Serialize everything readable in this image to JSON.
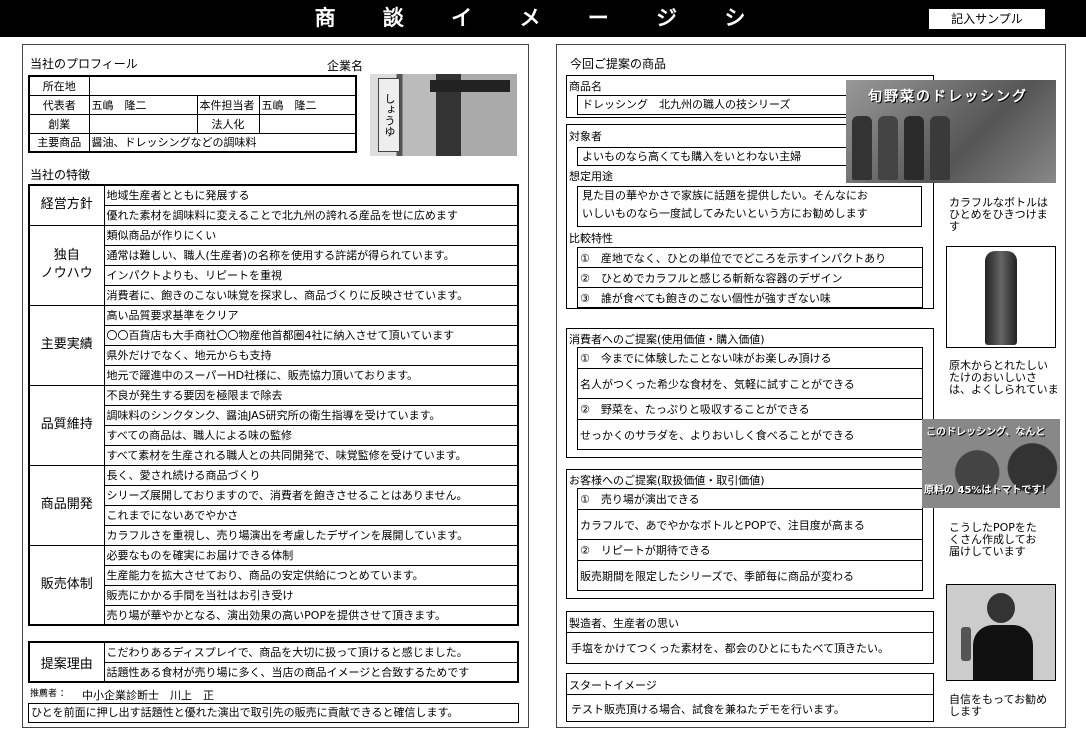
{
  "header": {
    "title": "商 談 イ メ ー ジ シ ー ト",
    "sample": "記入サンプル"
  },
  "left": {
    "profile_title": "当社のプロフィール",
    "company_label": "企業名",
    "profile": {
      "address_label": "所在地",
      "address": "",
      "rep_label": "代表者",
      "rep": "五嶋　隆二",
      "contact_label": "本件担当者",
      "contact": "五嶋　隆二",
      "founded_label": "創業",
      "founded": "",
      "incorp_label": "法人化",
      "incorp": "",
      "products_label": "主要商品",
      "products": "醤油、ドレッシングなどの調味料"
    },
    "shop_sign": "しょうゆ",
    "features_title": "当社の特徴",
    "features": [
      {
        "cat": "経営方針",
        "lines": [
          "地域生産者とともに発展する",
          "優れた素材を調味料に変えることで北九州の誇れる産品を世に広めます"
        ]
      },
      {
        "cat": "独自\nノウハウ",
        "lines": [
          "類似商品が作りにくい",
          "通常は難しい、職人(生産者)の名称を使用する許諾が得られています。",
          "インパクトよりも、リピートを重視",
          "消費者に、飽きのこない味覚を探求し、商品づくりに反映させています。"
        ]
      },
      {
        "cat": "主要実績",
        "lines": [
          "高い品質要求基準をクリア",
          "〇〇百貨店も大手商社〇〇物産他首都圏4社に納入させて頂いています",
          "県外だけでなく、地元からも支持",
          "地元で躍進中のスーパーHD社様に、販売協力頂いております。"
        ]
      },
      {
        "cat": "品質維持",
        "lines": [
          "不良が発生する要因を極限まで除去",
          "調味料のシンクタンク、醤油JAS研究所の衛生指導を受けています。",
          "すべての商品は、職人による味の監修",
          "すべて素材を生産される職人との共同開発で、味覚監修を受けています。"
        ]
      },
      {
        "cat": "商品開発",
        "lines": [
          "長く、愛され続ける商品づくり",
          "シリーズ展開しておりますので、消費者を飽きさせることはありません。",
          "これまでにないあでやかさ",
          "カラフルさを重視し、売り場演出を考慮したデザインを展開しています。"
        ]
      },
      {
        "cat": "販売体制",
        "lines": [
          "必要なものを確実にお届けできる体制",
          "生産能力を拡大させており、商品の安定供給につとめています。",
          "販売にかかる手間を当社はお引き受け",
          "売り場が華やかとなる、演出効果の高いPOPを提供させて頂きます。"
        ]
      }
    ],
    "reason": {
      "cat": "提案理由",
      "lines": [
        "こだわりあるディスプレイで、商品を大切に扱って頂けると感じました。",
        "話題性ある食材が売り場に多く、当店の商品イメージと合致するためです"
      ]
    },
    "recommender_label": "推薦者 ：",
    "recommender": "中小企業診断士　川上　正",
    "recommend_text": "ひとを前面に押し出す話題性と優れた演出で取引先の販売に貢献できると確信します。"
  },
  "right": {
    "title": "今回ご提案の商品",
    "product_label": "商品名",
    "product": "ドレッシング　北九州の職人の技シリーズ",
    "target_label": "対象者",
    "target": "よいものなら高くても購入をいとわない主婦",
    "usage_label": "想定用途",
    "usage": [
      "見た目の華やかさで家族に話題を提供したい。そんなにお",
      "いしいものなら一度試してみたいという方にお勧めします"
    ],
    "compare_label": "比較特性",
    "compare": [
      "①　産地でなく、ひとの単位ででどころを示すインパクトあり",
      "②　ひとめでカラフルと感じる斬新な容器のデザイン",
      "③　誰が食べても飽きのこない個性が強すぎない味"
    ],
    "consumer_label": "消費者へのご提案(使用価値・購入価値)",
    "consumer": [
      "①　今までに体験したことない味がお楽しみ頂ける",
      "名人がつくった希少な食材を、気軽に試すことができる",
      "②　野菜を、たっぷりと吸収することができる",
      "せっかくのサラダを、よりおいしく食べることができる"
    ],
    "customer_label": "お客様へのご提案(取扱価値・取引価値)",
    "customer": [
      "①　売り場が演出できる",
      "カラフルで、あでやかなボトルとPOPで、注目度が高まる",
      "②　リピートが期待できる",
      "販売期間を限定したシリーズで、季節毎に商品が変わる"
    ],
    "maker_label": "製造者、生産者の思い",
    "maker": "手塩をかけてつくった素材を、都会のひとにもたべて頂きたい。",
    "start_label": "スタートイメージ",
    "start": "テスト販売頂ける場合、試食を兼ねたデモを行います。",
    "photo1_text": "旬野菜のドレッシング",
    "cap1": [
      "カラフルなボトルは",
      "ひとめをひきつけま",
      "す"
    ],
    "cap2": [
      "原木からとれたしい",
      "たけのおいしいさ",
      "は、よくしられていま"
    ],
    "pop_text1": "このドレッシング、なんと",
    "pop_text2": "原料の 45%はトマトです！",
    "cap3": [
      "こうしたPOPをた",
      "くさん作成してお",
      "届けしています"
    ],
    "cap4": [
      "自信をもってお勧め",
      "します"
    ]
  }
}
